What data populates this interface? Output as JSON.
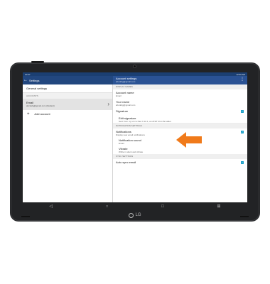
{
  "status_bar": {
    "time_left": "10:07",
    "time_right": "12:00 AM"
  },
  "app_bar": {
    "title": "Settings",
    "back_icon": "arrow-back-icon",
    "menu_icon": "more-vert-icon"
  },
  "right_header": {
    "title": "Account settings",
    "subtitle": "abcdefg@gmail.com"
  },
  "left_pane": {
    "general_label": "General settings",
    "accounts_section": "ACCOUNTS",
    "account_name": "Email",
    "account_email": "abcdefg@gmail.com (Default)",
    "add_account_label": "Add account"
  },
  "right_pane": {
    "display_section": "DISPLAY NAMES",
    "account_name_label": "Account name",
    "account_name_value": "Email",
    "your_name_label": "Your name",
    "your_name_value": "abcdefg@gmail.com",
    "signature_label": "Signature",
    "edit_signature_label": "Edit signature",
    "edit_signature_value": "Sent from my LG G Pad X 10.1, an AT&T 4G LTE tablet",
    "notification_section": "NOTIFICATION SETTINGS",
    "notifications_label": "Notifications",
    "notifications_desc": "Display new email notifications",
    "sound_label": "Notification sound",
    "sound_value": "Email",
    "vibrate_label": "Vibrate",
    "vibrate_value": "While in silent and vibrate",
    "sync_section": "SYNC SETTINGS",
    "auto_sync_label": "Auto sync email"
  },
  "nav_bar": {
    "back": "◁",
    "home": "○",
    "recents": "□",
    "extra": "⊞"
  },
  "logo_text": "LG",
  "colors": {
    "appbar": "#22477f",
    "checkbox": "#1aa0c8",
    "arrow": "#f07a1a"
  }
}
